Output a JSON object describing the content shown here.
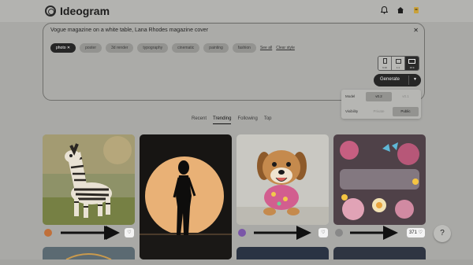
{
  "header": {
    "brand": "Ideogram",
    "icons": [
      "bell-icon",
      "home-icon",
      "user-icon"
    ]
  },
  "prompt": {
    "text": "Vogue magazine on a white table, Lana Rhodes magazine cover",
    "tags": [
      {
        "label": "photo",
        "active": true
      },
      {
        "label": "poster",
        "active": false
      },
      {
        "label": "3d render",
        "active": false
      },
      {
        "label": "typography",
        "active": false
      },
      {
        "label": "cinematic",
        "active": false
      },
      {
        "label": "painting",
        "active": false
      },
      {
        "label": "fashion",
        "active": false
      }
    ],
    "links": [
      "See all",
      "Clear style"
    ],
    "aspect_ratios": [
      "9:16",
      "1:1",
      "16:9"
    ],
    "generate_label": "Generate"
  },
  "settings": {
    "model_label": "Model",
    "model_options": [
      "v0.2",
      "v0.1"
    ],
    "visibility_label": "Visibility",
    "visibility_options": [
      "Private",
      "Public"
    ]
  },
  "tabs": [
    "Recent",
    "Trending",
    "Following",
    "Top"
  ],
  "active_tab": "Trending",
  "gallery": [
    {
      "subject": "zebra",
      "likes": "",
      "avatar_color": "#c0703a"
    },
    {
      "subject": "silhouette",
      "likes": "",
      "avatar_color": ""
    },
    {
      "subject": "puppy",
      "likes": "",
      "avatar_color": "#7a55a8"
    },
    {
      "subject": "corina",
      "likes": "371",
      "avatar_color": "#888888"
    }
  ],
  "help_label": "?",
  "colors": {
    "accent_dark": "#262626",
    "surface": "#a9a9a6"
  }
}
